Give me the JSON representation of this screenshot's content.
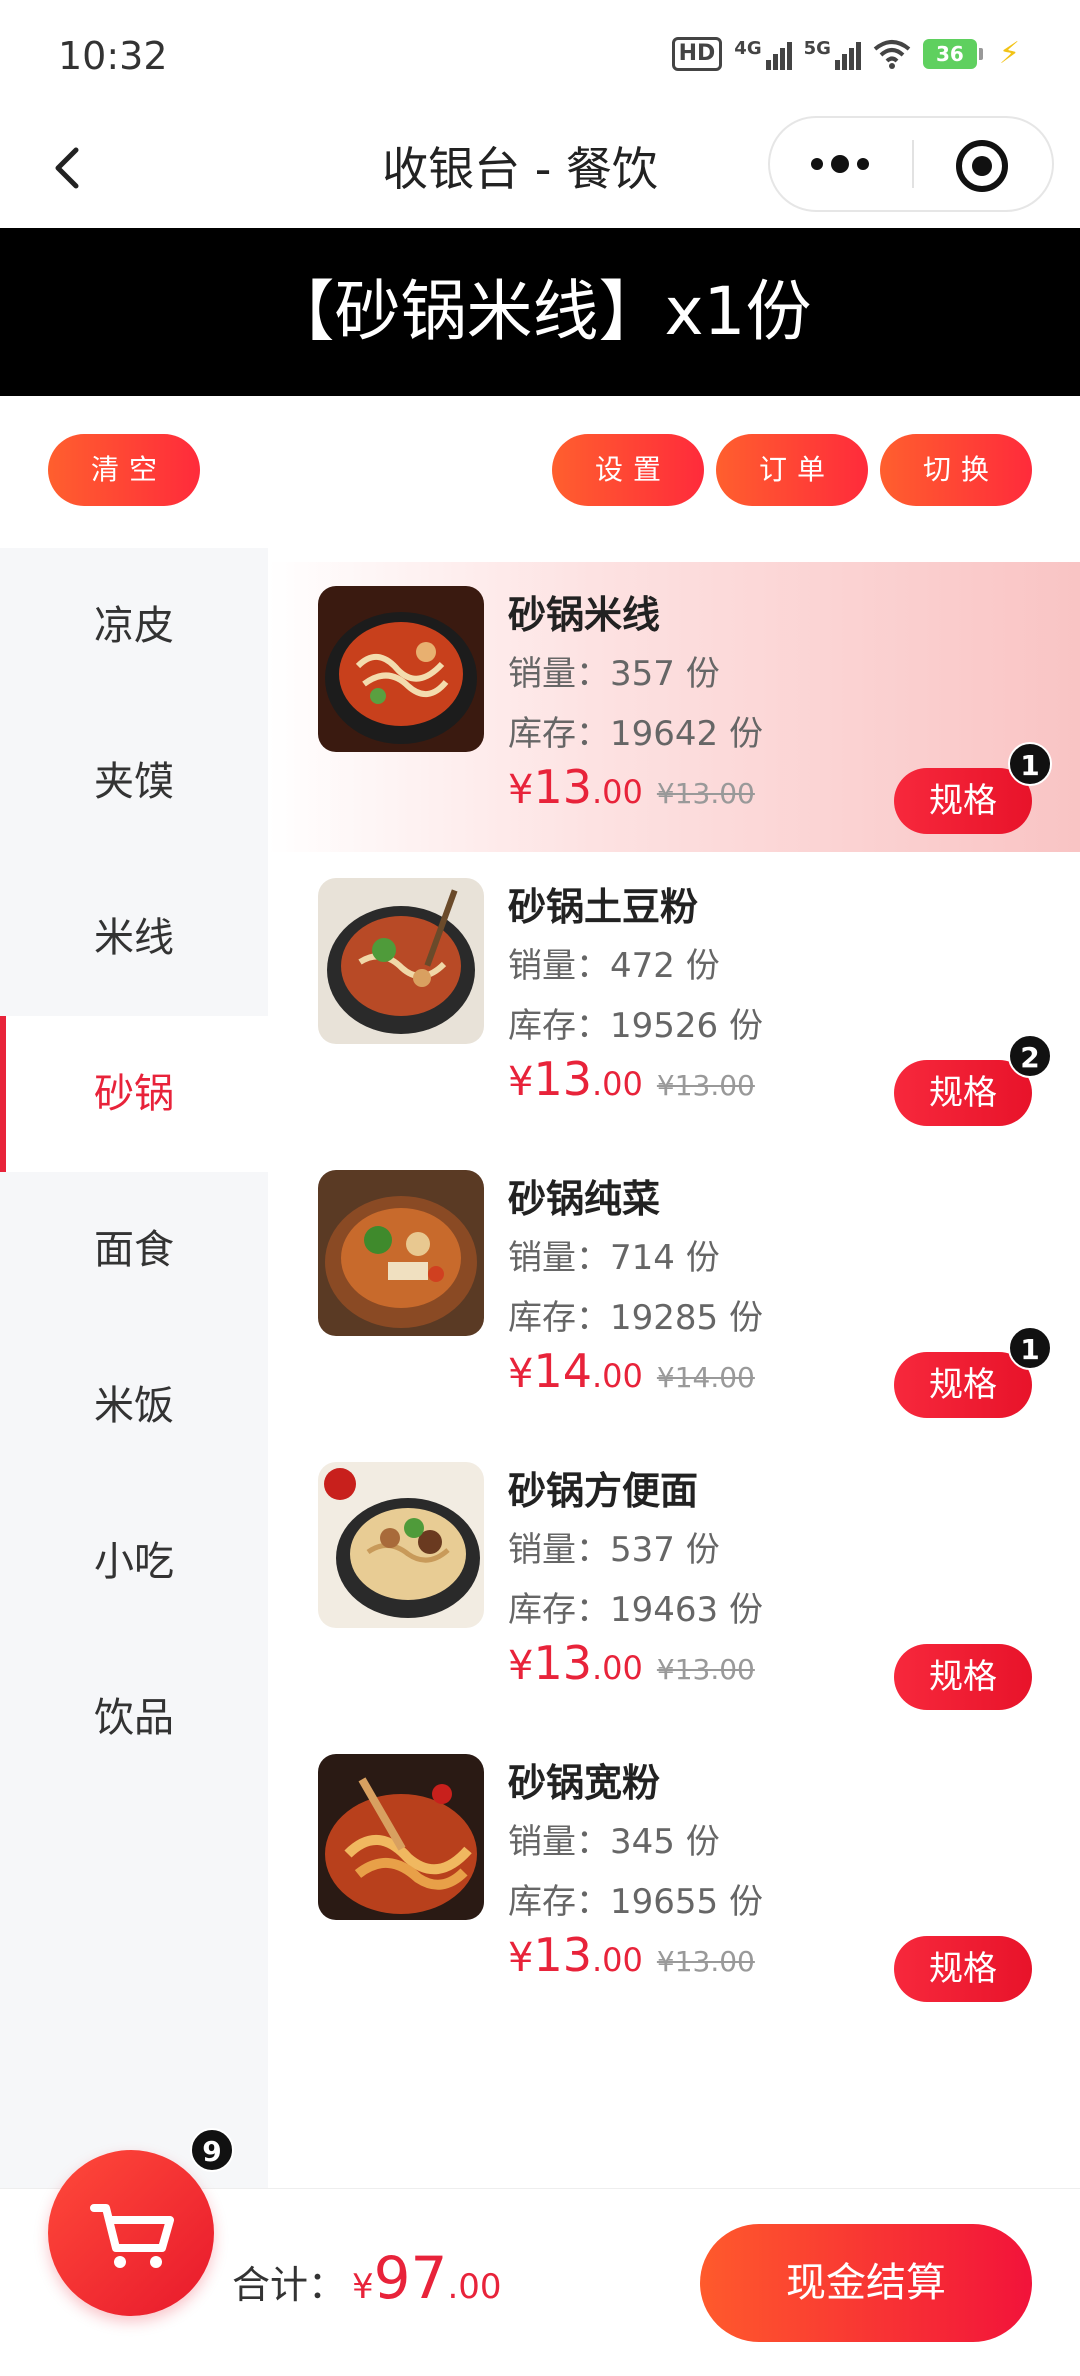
{
  "status_bar": {
    "time": "10:32",
    "hd_label": "HD",
    "signal_1": "4G",
    "signal_2": "5G",
    "battery": "36"
  },
  "nav": {
    "title": "收银台 - 餐饮"
  },
  "banner": {
    "text": "【砂锅米线】x1份"
  },
  "actions": {
    "clear": "清空",
    "settings": "设置",
    "orders": "订单",
    "switch": "切换"
  },
  "categories": [
    {
      "label": "凉皮"
    },
    {
      "label": "夹馍"
    },
    {
      "label": "米线"
    },
    {
      "label": "砂锅",
      "active": true
    },
    {
      "label": "面食"
    },
    {
      "label": "米饭"
    },
    {
      "label": "小吃"
    },
    {
      "label": "饮品"
    }
  ],
  "products": [
    {
      "name": "砂锅米线",
      "sales": "销量：357 份",
      "stock": "库存：19642 份",
      "price_symbol": "¥",
      "price_int": "13",
      "price_dec": ".00",
      "orig_price": "¥13.00",
      "spec_label": "规格",
      "qty": "1"
    },
    {
      "name": "砂锅土豆粉",
      "sales": "销量：472 份",
      "stock": "库存：19526 份",
      "price_symbol": "¥",
      "price_int": "13",
      "price_dec": ".00",
      "orig_price": "¥13.00",
      "spec_label": "规格",
      "qty": "2"
    },
    {
      "name": "砂锅纯菜",
      "sales": "销量：714 份",
      "stock": "库存：19285 份",
      "price_symbol": "¥",
      "price_int": "14",
      "price_dec": ".00",
      "orig_price": "¥14.00",
      "spec_label": "规格",
      "qty": "1"
    },
    {
      "name": "砂锅方便面",
      "sales": "销量：537 份",
      "stock": "库存：19463 份",
      "price_symbol": "¥",
      "price_int": "13",
      "price_dec": ".00",
      "orig_price": "¥13.00",
      "spec_label": "规格",
      "qty": ""
    },
    {
      "name": "砂锅宽粉",
      "sales": "销量：345 份",
      "stock": "库存：19655 份",
      "price_symbol": "¥",
      "price_int": "13",
      "price_dec": ".00",
      "orig_price": "¥13.00",
      "spec_label": "规格",
      "qty": ""
    }
  ],
  "cart": {
    "count": "9",
    "total_label": "合计：",
    "total_symbol": "¥",
    "total_int": "97",
    "total_dec": ".00",
    "checkout_label": "现金结算"
  },
  "colors": {
    "accent": "#e8233a",
    "banner_bg": "#000000",
    "sidebar_bg": "#f6f7f9"
  }
}
